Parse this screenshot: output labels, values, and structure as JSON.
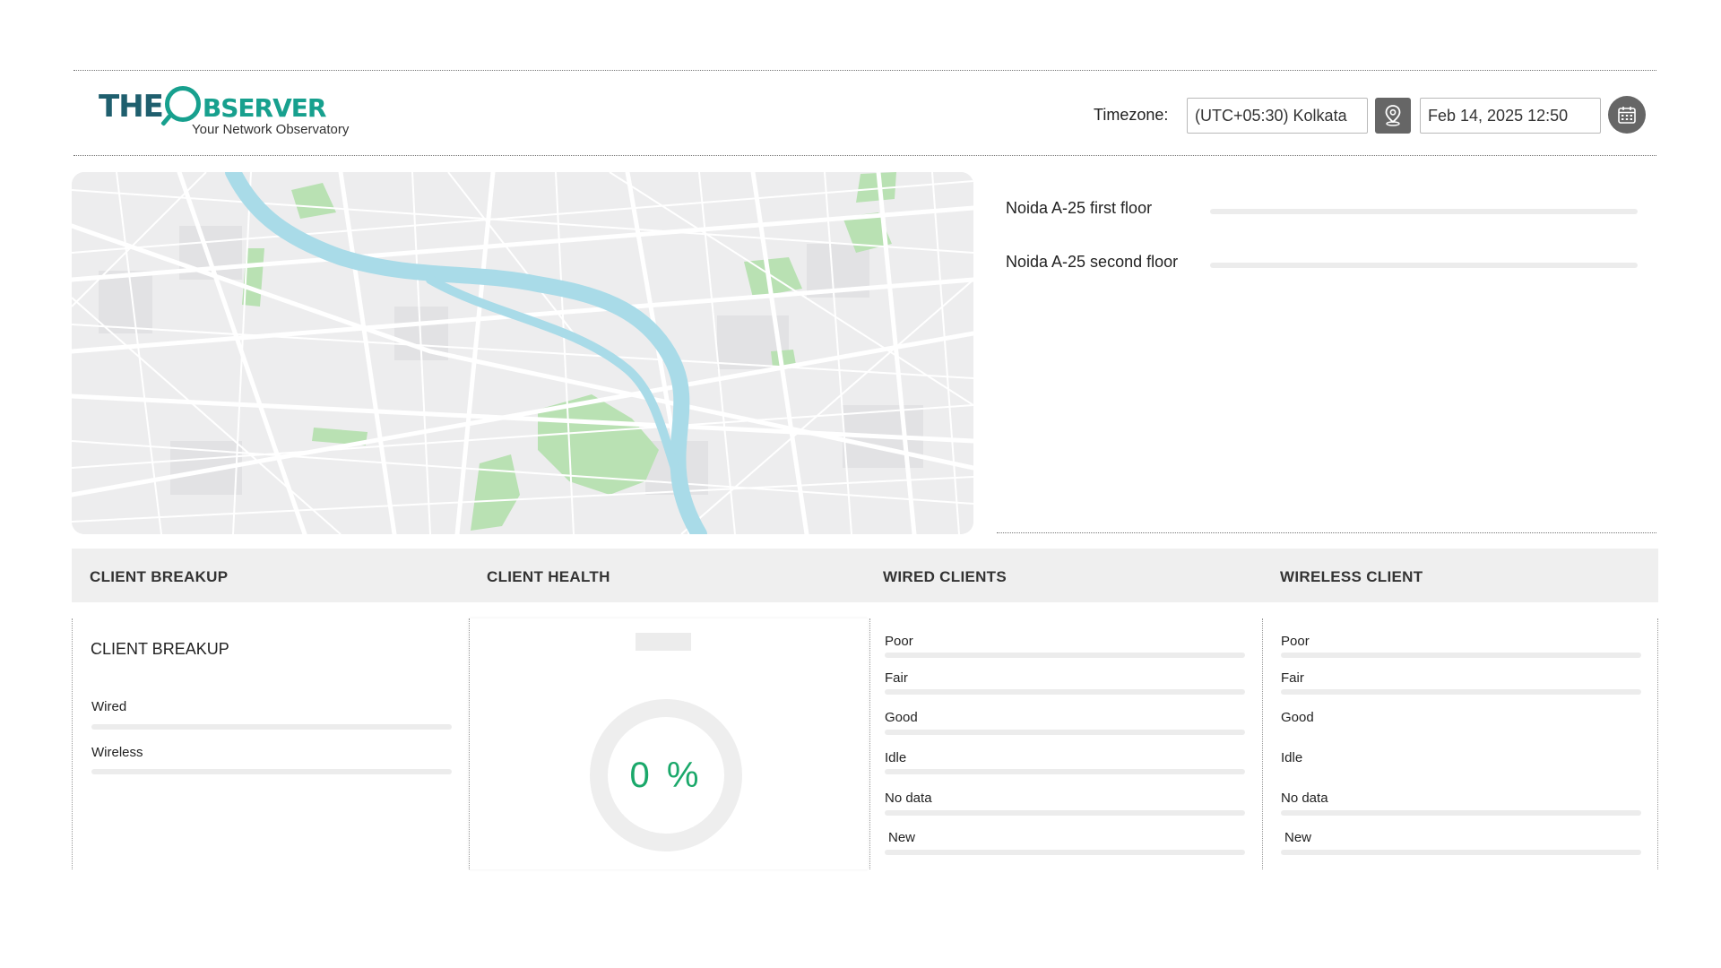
{
  "header": {
    "logo_title": "THE",
    "logo_title_rest": "BSERVER",
    "logo_tagline": "Your Network Observatory",
    "timezone_label": "Timezone:",
    "timezone_value": "(UTC+05:30) Kolkata",
    "datetime_value": "Feb 14, 2025 12:50",
    "icons": {
      "location": "location-pin-icon",
      "calendar": "calendar-icon"
    }
  },
  "floors": [
    {
      "label": "Noida A-25 first floor"
    },
    {
      "label": "Noida A-25 second floor"
    }
  ],
  "sections": {
    "client_breakup": "CLIENT BREAKUP",
    "client_health": "CLIENT HEALTH",
    "wired_clients": "WIRED CLIENTS",
    "wireless_client": "WIRELESS CLIENT"
  },
  "client_breakup": {
    "heading": "CLIENT BREAKUP",
    "rows": [
      {
        "label": "Wired"
      },
      {
        "label": "Wireless"
      }
    ]
  },
  "client_health": {
    "value": "0 %",
    "percent": 0
  },
  "wired_clients": {
    "rows": [
      {
        "label": "Poor"
      },
      {
        "label": "Fair"
      },
      {
        "label": "Good"
      },
      {
        "label": "Idle"
      },
      {
        "label": "No data"
      },
      {
        "label": "New"
      }
    ]
  },
  "wireless_client": {
    "rows": [
      {
        "label": "Poor"
      },
      {
        "label": "Fair"
      },
      {
        "label": "Good"
      },
      {
        "label": "Idle"
      },
      {
        "label": "No data"
      },
      {
        "label": "New"
      }
    ]
  },
  "colors": {
    "brand_dark": "#1f5f6e",
    "brand_accent": "#17a08e",
    "health_value": "#1aa86a",
    "river": "#a9dbe8",
    "park": "#b9e1b3"
  }
}
